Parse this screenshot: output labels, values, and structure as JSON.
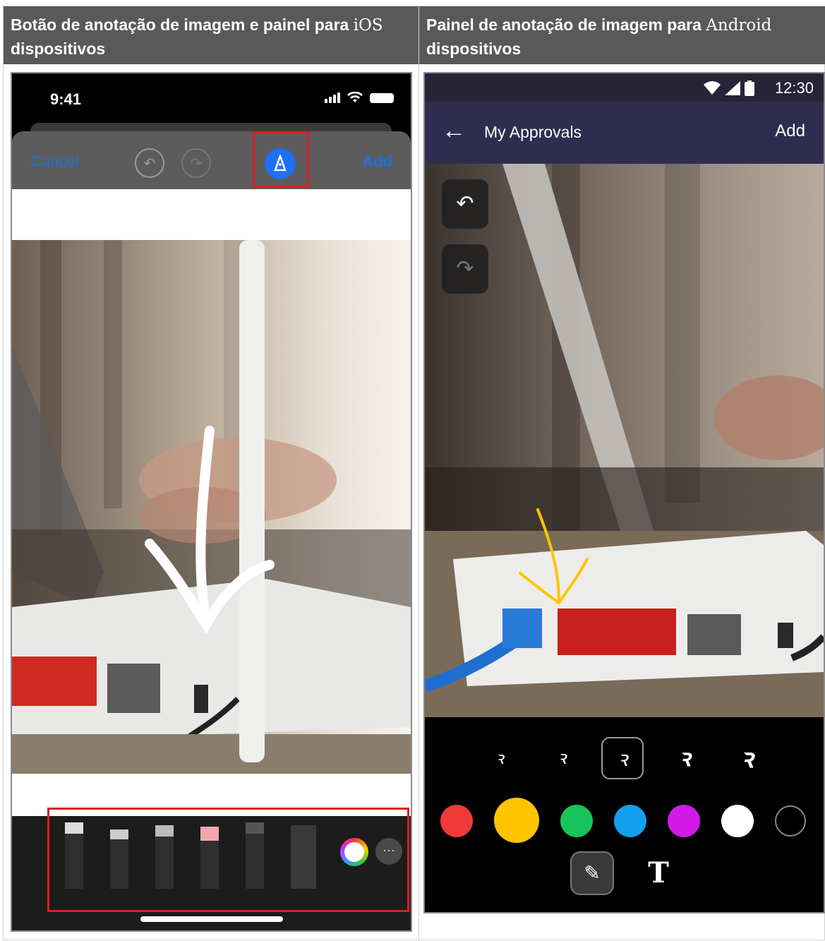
{
  "headers": {
    "left_prefix": "Botão de anotação de imagem e painel para ",
    "left_platform": "iOS",
    "left_suffix": "dispositivos",
    "right_prefix": "Painel de anotação de imagem para ",
    "right_platform": "Android",
    "right_suffix": "dispositivos"
  },
  "ios": {
    "time": "9:41",
    "cancel_label": "Cancel",
    "add_label": "Add",
    "tools": [
      "pen",
      "marker",
      "pencil",
      "eraser",
      "fountain-pen",
      "ruler"
    ],
    "more_label": "···"
  },
  "android": {
    "time": "12:30",
    "title": "My Approvals",
    "add_label": "Add",
    "strokes": [
      "extra-thin",
      "thin",
      "medium",
      "thick",
      "extra-thick"
    ],
    "selected_stroke": "medium",
    "colors": [
      "#f03a3a",
      "#ffc400",
      "#17c45b",
      "#12a0ef",
      "#d21ae8",
      "#ffffff",
      "#000000"
    ],
    "selected_color": "#ffc400",
    "icons": {
      "undo": "undo-icon",
      "redo": "redo-icon",
      "pen": "pen-icon",
      "text": "text-icon"
    }
  },
  "colors": {
    "header_bg": "#595959",
    "ios_link": "#1d6fe0",
    "highlight": "#e01e1e",
    "android_appbar": "#2f2d4f"
  }
}
